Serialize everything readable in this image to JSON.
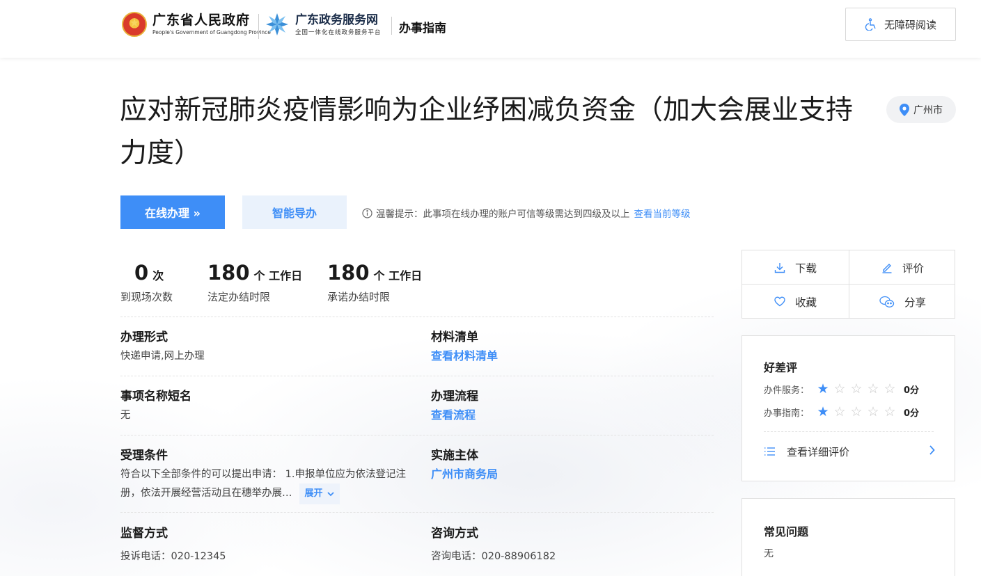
{
  "header": {
    "gov_name": "广东省人民政府",
    "gov_en": "People's Government of Guangdong Province",
    "portal_name": "广东政务服务网",
    "portal_sub": "全国一体化在线政务服务平台",
    "section_label": "办事指南",
    "accessibility_label": "无障碍阅读"
  },
  "item": {
    "title": "应对新冠肺炎疫情影响为企业纾困减负资金（加大会展业支持力度）",
    "location": "广州市"
  },
  "actions": {
    "online_label": "在线办理 »",
    "guide_label": "智能导办",
    "tip_text": "温馨提示：此事项在线办理的账户可信等级需达到四级及以上",
    "tip_link": "查看当前等级"
  },
  "stats": [
    {
      "value": "0",
      "unit": "次",
      "label": "到现场次数"
    },
    {
      "value": "180",
      "unit": "个 工作日",
      "label": "法定办结时限"
    },
    {
      "value": "180",
      "unit": "个 工作日",
      "label": "承诺办结时限"
    }
  ],
  "fields": {
    "form": {
      "title": "办理形式",
      "value": "快递申请,网上办理"
    },
    "materials": {
      "title": "材料清单",
      "link": "查看材料清单"
    },
    "short_name": {
      "title": "事项名称短名",
      "value": "无"
    },
    "process": {
      "title": "办理流程",
      "link": "查看流程"
    },
    "conditions": {
      "title": "受理条件",
      "value": "符合以下全部条件的可以提出申请： 1.申报单位应为依法登记注册，依法开展经营活动且在穗举办展…",
      "expand": "展开"
    },
    "agency": {
      "title": "实施主体",
      "link": "广州市商务局"
    },
    "supervision": {
      "title": "监督方式",
      "value": "投诉电话：020-12345"
    },
    "consult": {
      "title": "咨询方式",
      "value": "咨询电话：020-88906182"
    }
  },
  "side": {
    "download": "下载",
    "evaluate": "评价",
    "favorite": "收藏",
    "share": "分享",
    "rating_title": "好差评",
    "ratings": [
      {
        "label": "办件服务：",
        "stars": 1,
        "score": "0分"
      },
      {
        "label": "办事指南：",
        "stars": 1,
        "score": "0分"
      }
    ],
    "detail_link": "查看详细评价",
    "faq_title": "常见问题",
    "faq_value": "无"
  },
  "colors": {
    "accent": "#3e8ef7",
    "accent_light": "#eaf2fc"
  }
}
